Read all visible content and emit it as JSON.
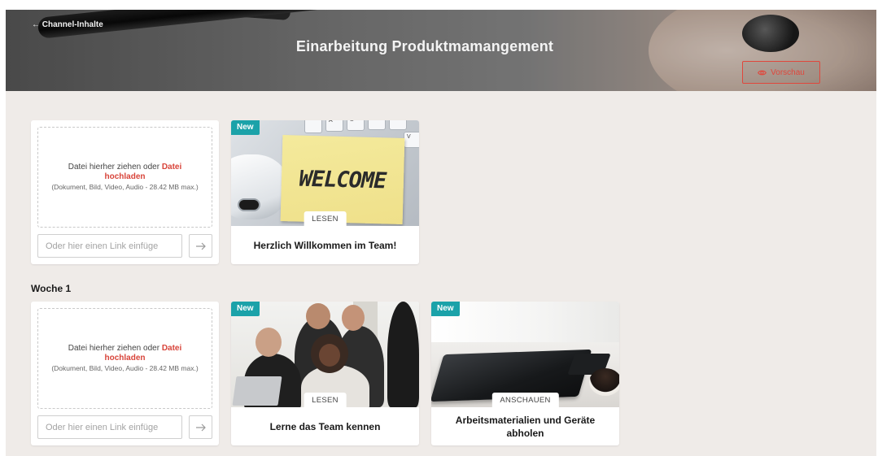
{
  "header": {
    "back_link": "← Channel-Inhalte",
    "title": "Einarbeitung Produktmamangement",
    "preview_button": "Vorschau"
  },
  "upload": {
    "drop_text": "Datei hierher ziehen oder",
    "upload_link": "Datei hochladen",
    "hint": "(Dokument, Bild, Video, Audio - 28.42 MB max.)",
    "link_placeholder": "Oder hier einen Link einfüge"
  },
  "sections": [
    {
      "label": "",
      "cards": [
        {
          "badge": "New",
          "action": "LESEN",
          "title": "Herzlich Willkommen im Team!",
          "image_text": "WELCOME"
        }
      ]
    },
    {
      "label": "Woche 1",
      "cards": [
        {
          "badge": "New",
          "action": "LESEN",
          "title": "Lerne das Team kennen"
        },
        {
          "badge": "New",
          "action": "ANSCHAUEN",
          "title": "Arbeitsmaterialien und Geräte abholen"
        }
      ]
    }
  ],
  "colors": {
    "accent": "#d8443a",
    "badge": "#1ba2a9",
    "background": "#efebe8"
  },
  "icons": {
    "preview": "eye-icon",
    "submit_link": "arrow-right-icon"
  }
}
